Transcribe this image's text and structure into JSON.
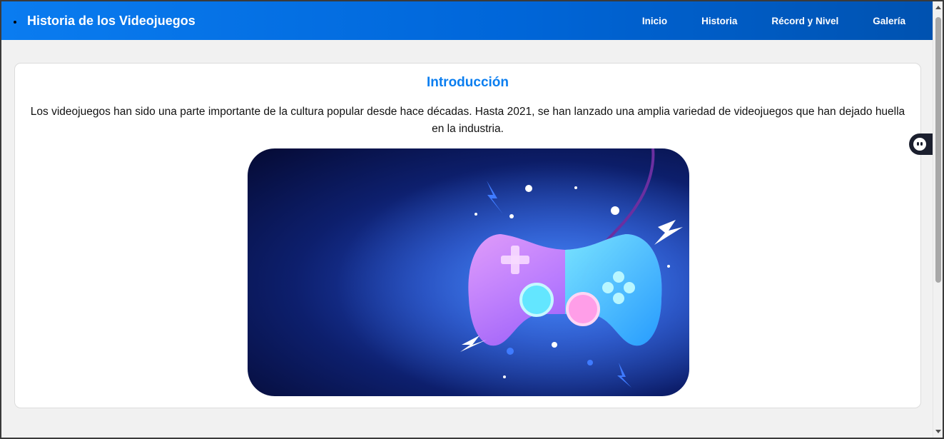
{
  "header": {
    "title": "Historia de los Videojuegos",
    "nav": [
      "Inicio",
      "Historia",
      "Récord y Nivel",
      "Galería"
    ]
  },
  "intro": {
    "heading": "Introducción",
    "text": "Los videojuegos han sido una parte importante de la cultura popular desde hace décadas. Hasta 2021, se han lanzado una amplia variedad de videojuegos que han dejado huella en la industria."
  },
  "colors": {
    "nav_gradient_start": "#0a7cf0",
    "nav_gradient_end": "#0052b0",
    "heading": "#0a7ef0",
    "page_bg": "#f1f1f1"
  },
  "icons": {
    "hero": "gamepad-illustration",
    "floating": "assistant-bubble-icon"
  }
}
